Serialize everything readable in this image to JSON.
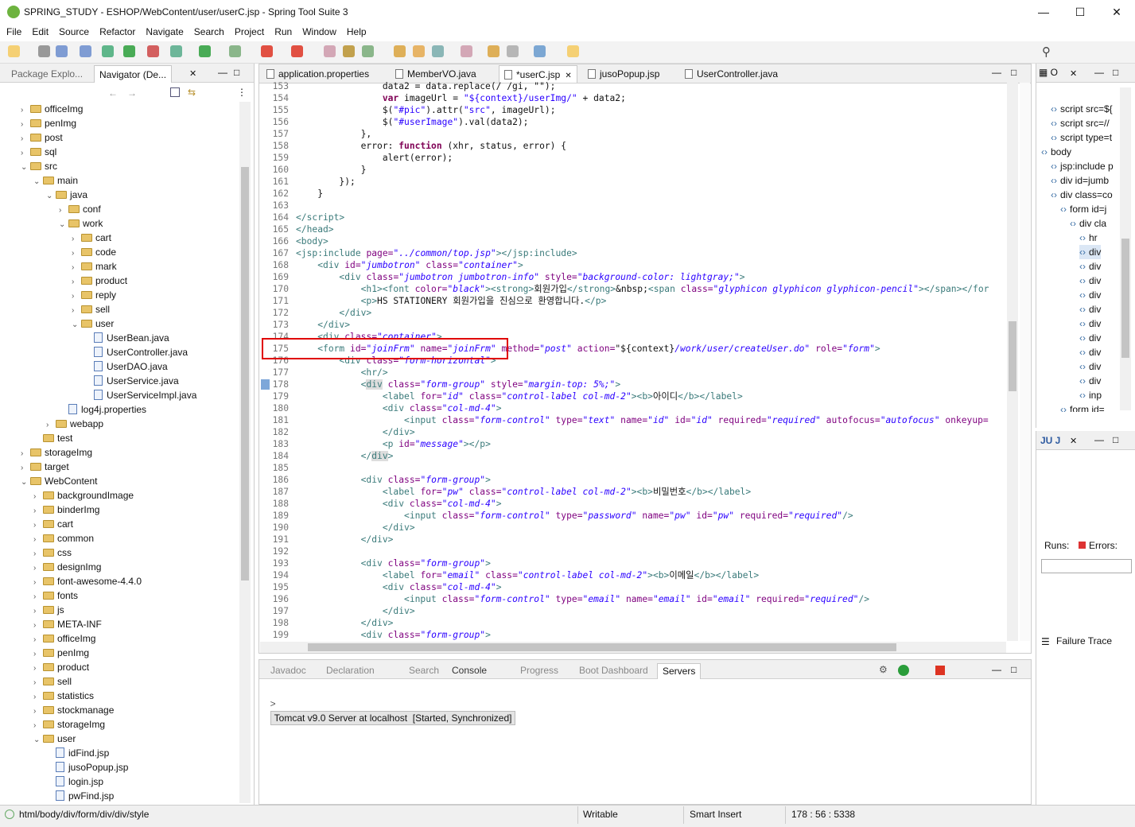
{
  "window": {
    "title": "SPRING_STUDY - ESHOP/WebContent/user/userC.jsp - Spring Tool Suite 3"
  },
  "menu": [
    "File",
    "Edit",
    "Source",
    "Refactor",
    "Navigate",
    "Search",
    "Project",
    "Run",
    "Window",
    "Help"
  ],
  "left_tabs": [
    "Package Explo...",
    "Navigator (De..."
  ],
  "tree": [
    {
      "label": "officeImg",
      "indent": 2,
      "type": "folder",
      "arrow": ">"
    },
    {
      "label": "penImg",
      "indent": 2,
      "type": "folder",
      "arrow": ">"
    },
    {
      "label": "post",
      "indent": 2,
      "type": "folder",
      "arrow": ">"
    },
    {
      "label": "sql",
      "indent": 2,
      "type": "folder",
      "arrow": ">"
    },
    {
      "label": "src",
      "indent": 2,
      "type": "folder",
      "arrow": "v"
    },
    {
      "label": "main",
      "indent": 3,
      "type": "folder",
      "arrow": "v"
    },
    {
      "label": "java",
      "indent": 4,
      "type": "folder",
      "arrow": "v"
    },
    {
      "label": "conf",
      "indent": 5,
      "type": "folder",
      "arrow": ">"
    },
    {
      "label": "work",
      "indent": 5,
      "type": "folder",
      "arrow": "v"
    },
    {
      "label": "cart",
      "indent": 6,
      "type": "folder",
      "arrow": ">"
    },
    {
      "label": "code",
      "indent": 6,
      "type": "folder",
      "arrow": ">"
    },
    {
      "label": "mark",
      "indent": 6,
      "type": "folder",
      "arrow": ">"
    },
    {
      "label": "product",
      "indent": 6,
      "type": "folder",
      "arrow": ">"
    },
    {
      "label": "reply",
      "indent": 6,
      "type": "folder",
      "arrow": ">"
    },
    {
      "label": "sell",
      "indent": 6,
      "type": "folder",
      "arrow": ">"
    },
    {
      "label": "user",
      "indent": 6,
      "type": "folder",
      "arrow": "v"
    },
    {
      "label": "UserBean.java",
      "indent": 7,
      "type": "file",
      "arrow": ""
    },
    {
      "label": "UserController.java",
      "indent": 7,
      "type": "file",
      "arrow": ""
    },
    {
      "label": "UserDAO.java",
      "indent": 7,
      "type": "file",
      "arrow": ""
    },
    {
      "label": "UserService.java",
      "indent": 7,
      "type": "file",
      "arrow": ""
    },
    {
      "label": "UserServiceImpl.java",
      "indent": 7,
      "type": "file",
      "arrow": ""
    },
    {
      "label": "log4j.properties",
      "indent": 5,
      "type": "file",
      "arrow": ""
    },
    {
      "label": "webapp",
      "indent": 4,
      "type": "folder",
      "arrow": ">"
    },
    {
      "label": "test",
      "indent": 3,
      "type": "folder",
      "arrow": ""
    },
    {
      "label": "storageImg",
      "indent": 2,
      "type": "folder",
      "arrow": ">"
    },
    {
      "label": "target",
      "indent": 2,
      "type": "folder",
      "arrow": ">"
    },
    {
      "label": "WebContent",
      "indent": 2,
      "type": "folder",
      "arrow": "v"
    },
    {
      "label": "backgroundImage",
      "indent": 3,
      "type": "folder",
      "arrow": ">"
    },
    {
      "label": "binderImg",
      "indent": 3,
      "type": "folder",
      "arrow": ">"
    },
    {
      "label": "cart",
      "indent": 3,
      "type": "folder",
      "arrow": ">"
    },
    {
      "label": "common",
      "indent": 3,
      "type": "folder",
      "arrow": ">"
    },
    {
      "label": "css",
      "indent": 3,
      "type": "folder",
      "arrow": ">"
    },
    {
      "label": "designImg",
      "indent": 3,
      "type": "folder",
      "arrow": ">"
    },
    {
      "label": "font-awesome-4.4.0",
      "indent": 3,
      "type": "folder",
      "arrow": ">"
    },
    {
      "label": "fonts",
      "indent": 3,
      "type": "folder",
      "arrow": ">"
    },
    {
      "label": "js",
      "indent": 3,
      "type": "folder",
      "arrow": ">"
    },
    {
      "label": "META-INF",
      "indent": 3,
      "type": "folder",
      "arrow": ">"
    },
    {
      "label": "officeImg",
      "indent": 3,
      "type": "folder",
      "arrow": ">"
    },
    {
      "label": "penImg",
      "indent": 3,
      "type": "folder",
      "arrow": ">"
    },
    {
      "label": "product",
      "indent": 3,
      "type": "folder",
      "arrow": ">"
    },
    {
      "label": "sell",
      "indent": 3,
      "type": "folder",
      "arrow": ">"
    },
    {
      "label": "statistics",
      "indent": 3,
      "type": "folder",
      "arrow": ">"
    },
    {
      "label": "stockmanage",
      "indent": 3,
      "type": "folder",
      "arrow": ">"
    },
    {
      "label": "storageImg",
      "indent": 3,
      "type": "folder",
      "arrow": ">"
    },
    {
      "label": "user",
      "indent": 3,
      "type": "folder",
      "arrow": "v"
    },
    {
      "label": "idFind.jsp",
      "indent": 4,
      "type": "file",
      "arrow": ""
    },
    {
      "label": "jusoPopup.jsp",
      "indent": 4,
      "type": "file",
      "arrow": ""
    },
    {
      "label": "login.jsp",
      "indent": 4,
      "type": "file",
      "arrow": ""
    },
    {
      "label": "pwFind.jsp",
      "indent": 4,
      "type": "file",
      "arrow": ""
    }
  ],
  "editor_tabs": [
    {
      "label": "application.properties",
      "active": false
    },
    {
      "label": "MemberVO.java",
      "active": false
    },
    {
      "label": "*userC.jsp",
      "active": true
    },
    {
      "label": "jusoPopup.jsp",
      "active": false
    },
    {
      "label": "UserController.java",
      "active": false
    }
  ],
  "code": [
    {
      "n": "153",
      "html": "                <span>data2 = data.replace(/ /gi, \"\");</span>"
    },
    {
      "n": "154",
      "html": "                <span class=\"kw\">var</span> imageUrl = <span class=\"str\">\"${context}/userImg/\"</span> + data2;"
    },
    {
      "n": "155",
      "html": "                $(<span class=\"str\">\"#pic\"</span>).attr(<span class=\"str\">\"src\"</span>, imageUrl);"
    },
    {
      "n": "156",
      "html": "                $(<span class=\"str\">\"#userImage\"</span>).val(data2);"
    },
    {
      "n": "157",
      "html": "            },"
    },
    {
      "n": "158",
      "html": "            error: <span class=\"kw\">function</span> (xhr, status, error) {"
    },
    {
      "n": "159",
      "html": "                alert(error);"
    },
    {
      "n": "160",
      "html": "            }"
    },
    {
      "n": "161",
      "html": "        });"
    },
    {
      "n": "162",
      "html": "    }"
    },
    {
      "n": "163",
      "html": ""
    },
    {
      "n": "164",
      "html": "<span class=\"tag\">&lt;/script&gt;</span>"
    },
    {
      "n": "165",
      "html": "<span class=\"tag\">&lt;/head&gt;</span>"
    },
    {
      "n": "166",
      "html": "<span class=\"tag\">&lt;body&gt;</span>"
    },
    {
      "n": "167",
      "html": "<span class=\"tag\">&lt;jsp:include</span> <span class=\"attr\">page=</span><span class=\"val\">\"../common/top.jsp\"</span><span class=\"tag\">&gt;&lt;/jsp:include&gt;</span>"
    },
    {
      "n": "168",
      "html": "    <span class=\"tag\">&lt;div</span> <span class=\"attr\">id=</span><span class=\"val\">\"jumbotron\"</span> <span class=\"attr\">class=</span><span class=\"val\">\"container\"</span><span class=\"tag\">&gt;</span>"
    },
    {
      "n": "169",
      "html": "        <span class=\"tag\">&lt;div</span> <span class=\"attr\">class=</span><span class=\"val\">\"jumbotron jumbotron-info\"</span> <span class=\"attr\">style=</span><span class=\"val\">\"background-color: lightgray;\"</span><span class=\"tag\">&gt;</span>"
    },
    {
      "n": "170",
      "html": "            <span class=\"tag\">&lt;h1&gt;&lt;font</span> <span class=\"attr\">color=</span><span class=\"val\">\"black\"</span><span class=\"tag\">&gt;&lt;strong&gt;</span>회원가입<span class=\"tag\">&lt;/strong&gt;</span>&amp;nbsp;<span class=\"tag\">&lt;span</span> <span class=\"attr\">class=</span><span class=\"val\">\"glyphicon glyphicon glyphicon-pencil\"</span><span class=\"tag\">&gt;&lt;/span&gt;&lt;/for</span>"
    },
    {
      "n": "171",
      "html": "            <span class=\"tag\">&lt;p&gt;</span>HS STATIONERY 회원가입을 진심으로 환영합니다.<span class=\"tag\">&lt;/p&gt;</span>"
    },
    {
      "n": "172",
      "html": "        <span class=\"tag\">&lt;/div&gt;</span>"
    },
    {
      "n": "173",
      "html": "    <span class=\"tag\">&lt;/div&gt;</span>"
    },
    {
      "n": "174",
      "html": "    <span class=\"tag\">&lt;div</span> <span class=\"attr\">class=</span><span class=\"val\">\"container\"</span><span class=\"tag\">&gt;</span>"
    },
    {
      "n": "175",
      "html": "    <span class=\"tag\">&lt;form</span> <span class=\"attr\">id=</span><span class=\"val\">\"joinFrm\"</span> <span class=\"attr\">name=</span><span class=\"val\">\"joinFrm\"</span> <span class=\"attr\">method=</span><span class=\"val\">\"post\"</span> <span class=\"attr\">action=</span>\"${context}<span class=\"val\">/work/user/createUser.do\"</span> <span class=\"attr\">role=</span><span class=\"val\">\"form\"</span><span class=\"tag\">&gt;</span>"
    },
    {
      "n": "176",
      "html": "        <span class=\"tag\">&lt;div</span> <span class=\"attr\">class=</span><span class=\"val\">\"form-horizontal\"</span><span class=\"tag\">&gt;</span>"
    },
    {
      "n": "177",
      "html": "            <span class=\"tag\">&lt;hr/&gt;</span>"
    },
    {
      "n": "178",
      "html": "            <span class=\"tag\">&lt;<span style=\"background:#ddd\">div</span></span> <span class=\"attr\">class=</span><span class=\"val\">\"form-group\"</span> <span class=\"attr\">style=</span><span class=\"val\">\"margin-top: 5%;\"</span><span class=\"tag\">&gt;</span>"
    },
    {
      "n": "179",
      "html": "                <span class=\"tag\">&lt;label</span> <span class=\"attr\">for=</span><span class=\"val\">\"id\"</span> <span class=\"attr\">class=</span><span class=\"val\">\"control-label col-md-2\"</span><span class=\"tag\">&gt;&lt;b&gt;</span>아이디<span class=\"tag\">&lt;/b&gt;&lt;/label&gt;</span>"
    },
    {
      "n": "180",
      "html": "                <span class=\"tag\">&lt;div</span> <span class=\"attr\">class=</span><span class=\"val\">\"col-md-4\"</span><span class=\"tag\">&gt;</span>"
    },
    {
      "n": "181",
      "html": "                    <span class=\"tag\">&lt;input</span> <span class=\"attr\">class=</span><span class=\"val\">\"form-control\"</span> <span class=\"attr\">type=</span><span class=\"val\">\"text\"</span> <span class=\"attr\">name=</span><span class=\"val\">\"id\"</span> <span class=\"attr\">id=</span><span class=\"val\">\"id\"</span> <span class=\"attr\">required=</span><span class=\"val\">\"required\"</span> <span class=\"attr\">autofocus=</span><span class=\"val\">\"autofocus\"</span> <span class=\"attr\">onkeyup=</span>"
    },
    {
      "n": "182",
      "html": "                <span class=\"tag\">&lt;/div&gt;</span>"
    },
    {
      "n": "183",
      "html": "                <span class=\"tag\">&lt;p</span> <span class=\"attr\">id=</span><span class=\"val\">\"message\"</span><span class=\"tag\">&gt;&lt;/p&gt;</span>"
    },
    {
      "n": "184",
      "html": "            <span class=\"tag\">&lt;/<span style=\"background:#ddd\">div</span>&gt;</span>"
    },
    {
      "n": "185",
      "html": ""
    },
    {
      "n": "186",
      "html": "            <span class=\"tag\">&lt;div</span> <span class=\"attr\">class=</span><span class=\"val\">\"form-group\"</span><span class=\"tag\">&gt;</span>"
    },
    {
      "n": "187",
      "html": "                <span class=\"tag\">&lt;label</span> <span class=\"attr\">for=</span><span class=\"val\">\"pw\"</span> <span class=\"attr\">class=</span><span class=\"val\">\"control-label col-md-2\"</span><span class=\"tag\">&gt;&lt;b&gt;</span>비밀번호<span class=\"tag\">&lt;/b&gt;&lt;/label&gt;</span>"
    },
    {
      "n": "188",
      "html": "                <span class=\"tag\">&lt;div</span> <span class=\"attr\">class=</span><span class=\"val\">\"col-md-4\"</span><span class=\"tag\">&gt;</span>"
    },
    {
      "n": "189",
      "html": "                    <span class=\"tag\">&lt;input</span> <span class=\"attr\">class=</span><span class=\"val\">\"form-control\"</span> <span class=\"attr\">type=</span><span class=\"val\">\"password\"</span> <span class=\"attr\">name=</span><span class=\"val\">\"pw\"</span> <span class=\"attr\">id=</span><span class=\"val\">\"pw\"</span> <span class=\"attr\">required=</span><span class=\"val\">\"required\"</span><span class=\"tag\">/&gt;</span>"
    },
    {
      "n": "190",
      "html": "                <span class=\"tag\">&lt;/div&gt;</span>"
    },
    {
      "n": "191",
      "html": "            <span class=\"tag\">&lt;/div&gt;</span>"
    },
    {
      "n": "192",
      "html": ""
    },
    {
      "n": "193",
      "html": "            <span class=\"tag\">&lt;div</span> <span class=\"attr\">class=</span><span class=\"val\">\"form-group\"</span><span class=\"tag\">&gt;</span>"
    },
    {
      "n": "194",
      "html": "                <span class=\"tag\">&lt;label</span> <span class=\"attr\">for=</span><span class=\"val\">\"email\"</span> <span class=\"attr\">class=</span><span class=\"val\">\"control-label col-md-2\"</span><span class=\"tag\">&gt;&lt;b&gt;</span>이메일<span class=\"tag\">&lt;/b&gt;&lt;/label&gt;</span>"
    },
    {
      "n": "195",
      "html": "                <span class=\"tag\">&lt;div</span> <span class=\"attr\">class=</span><span class=\"val\">\"col-md-4\"</span><span class=\"tag\">&gt;</span>"
    },
    {
      "n": "196",
      "html": "                    <span class=\"tag\">&lt;input</span> <span class=\"attr\">class=</span><span class=\"val\">\"form-control\"</span> <span class=\"attr\">type=</span><span class=\"val\">\"email\"</span> <span class=\"attr\">name=</span><span class=\"val\">\"email\"</span> <span class=\"attr\">id=</span><span class=\"val\">\"email\"</span> <span class=\"attr\">required=</span><span class=\"val\">\"required\"</span><span class=\"tag\">/&gt;</span>"
    },
    {
      "n": "197",
      "html": "                <span class=\"tag\">&lt;/div&gt;</span>"
    },
    {
      "n": "198",
      "html": "            <span class=\"tag\">&lt;/div&gt;</span>"
    },
    {
      "n": "199",
      "html": "            <span class=\"tag\">&lt;div</span> <span class=\"attr\">class=</span><span class=\"val\">\"form-group\"</span><span class=\"tag\">&gt;</span>"
    }
  ],
  "bottom_tabs": [
    "Javadoc",
    "Declaration",
    "Search",
    "Console",
    "Progress",
    "Boot Dashboard",
    "Servers"
  ],
  "server_row": "Tomcat v9.0 Server at localhost  [Started, Synchronized]",
  "outline_tab": "O",
  "outline": [
    {
      "label": "script src=${",
      "indent": 1
    },
    {
      "label": "script src=//",
      "indent": 1
    },
    {
      "label": "script type=t",
      "indent": 1
    },
    {
      "label": "body",
      "indent": 0
    },
    {
      "label": "jsp:include p",
      "indent": 1
    },
    {
      "label": "div id=jumb",
      "indent": 1
    },
    {
      "label": "div class=co",
      "indent": 1
    },
    {
      "label": "form id=j",
      "indent": 2
    },
    {
      "label": "div cla",
      "indent": 3
    },
    {
      "label": "hr",
      "indent": 4
    },
    {
      "label": "div",
      "indent": 4
    },
    {
      "label": "div",
      "indent": 4
    },
    {
      "label": "div",
      "indent": 4
    },
    {
      "label": "div",
      "indent": 4
    },
    {
      "label": "div",
      "indent": 4
    },
    {
      "label": "div",
      "indent": 4
    },
    {
      "label": "div",
      "indent": 4
    },
    {
      "label": "div",
      "indent": 4
    },
    {
      "label": "div",
      "indent": 4
    },
    {
      "label": "div",
      "indent": 4
    },
    {
      "label": "inp",
      "indent": 4
    },
    {
      "label": "form id=",
      "indent": 2
    }
  ],
  "junit": {
    "tab": "JU J",
    "runs": "Runs:",
    "errors": "Errors:",
    "failure_trace": "Failure Trace"
  },
  "status": {
    "path": "html/body/div/form/div/div/style",
    "writable": "Writable",
    "insert": "Smart Insert",
    "position": "178 : 56 : 5338"
  }
}
